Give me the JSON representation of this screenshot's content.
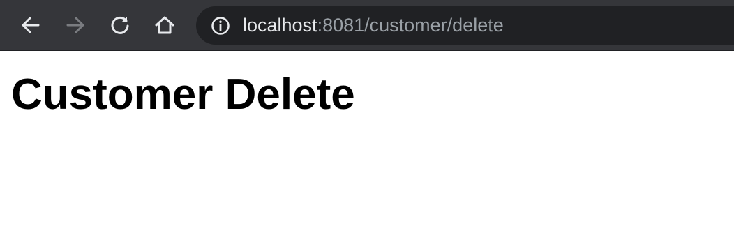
{
  "browser": {
    "back_icon": "arrow-left-icon",
    "forward_icon": "arrow-right-icon",
    "reload_icon": "reload-icon",
    "home_icon": "home-icon",
    "site_info_icon": "info-icon",
    "url_host": "localhost",
    "url_path": ":8081/customer/delete",
    "toolbar_color": "#35363a",
    "omnibox_color": "#202124",
    "forward_enabled": false
  },
  "page": {
    "title": "Customer Delete"
  }
}
